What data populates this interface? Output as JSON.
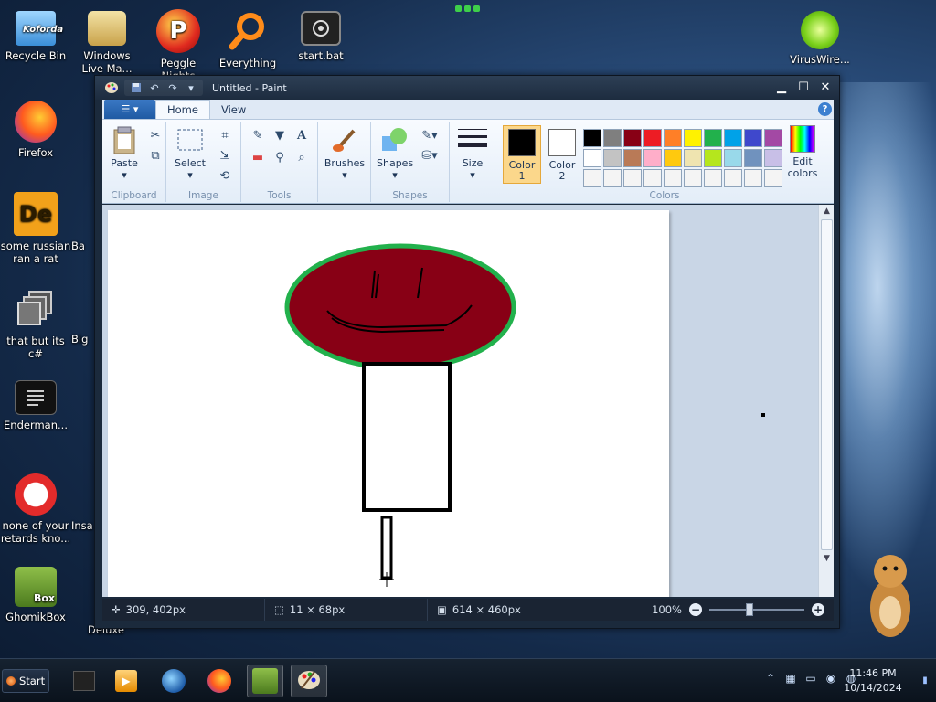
{
  "desktop": {
    "icons": [
      {
        "label": "Recycle Bin",
        "icon": "recycle-bin-icon"
      },
      {
        "label": "Windows Live Ma...",
        "icon": "windows-live-mail-icon"
      },
      {
        "label": "Peggle Nights",
        "icon": "peggle-icon"
      },
      {
        "label": "Everything",
        "icon": "search-magnifier-icon"
      },
      {
        "label": "start.bat",
        "icon": "batch-file-icon"
      },
      {
        "label": "VirusWire...",
        "icon": "lime-icon"
      },
      {
        "label": "Firefox",
        "icon": "firefox-icon"
      },
      {
        "label": "some russian ran a rat",
        "icon": "de-app-icon"
      },
      {
        "label": "that but its c#",
        "icon": "stacked-windows-icon"
      },
      {
        "label": "Enderman...",
        "icon": "console-icon"
      },
      {
        "label": "none of your retards kno...",
        "icon": "red-bird-icon"
      },
      {
        "label": "GhomikBox",
        "icon": "hamster-box-icon"
      },
      {
        "label": "Ba",
        "icon": "partial-icon"
      },
      {
        "label": "Big",
        "icon": "partial-icon"
      },
      {
        "label": "Insa",
        "icon": "partial-icon"
      },
      {
        "label": "Deluxe",
        "icon": "partial-icon"
      }
    ],
    "icon_text_badges": {
      "recycle": "Koforda",
      "de": "De",
      "ghomik": "Box"
    }
  },
  "paint": {
    "title": "Untitled - Paint",
    "tabs": [
      "Home",
      "View"
    ],
    "active_tab": "Home",
    "help": "?",
    "groups": {
      "clipboard": {
        "label": "Clipboard",
        "paste": "Paste"
      },
      "image": {
        "label": "Image",
        "select": "Select"
      },
      "tools": {
        "label": "Tools",
        "text_tool": "A"
      },
      "brushes": {
        "label": "Brushes"
      },
      "shapes": {
        "label": "Shapes",
        "shapes_btn": "Shapes"
      },
      "size": {
        "label": "Size"
      },
      "colors": {
        "label": "Colors",
        "color1": "Color 1",
        "color1_top": "Color",
        "color1_num": "1",
        "color2_top": "Color",
        "color2_num": "2",
        "edit_colors_top": "Edit",
        "edit_colors_bottom": "colors",
        "color1_value": "#000000",
        "color2_value": "#ffffff",
        "palette_row1": [
          "#000000",
          "#7f7f7f",
          "#880015",
          "#ed1c24",
          "#ff7f27",
          "#fff200",
          "#22b14c",
          "#00a2e8",
          "#3f48cc",
          "#a349a4"
        ],
        "palette_row2": [
          "#ffffff",
          "#c3c3c3",
          "#b97a57",
          "#ffaec9",
          "#ffc90e",
          "#efe4b0",
          "#b5e61d",
          "#99d9ea",
          "#7092be",
          "#c8bfe7"
        ],
        "palette_row3": [
          "#f4f4f4",
          "#f4f4f4",
          "#f4f4f4",
          "#f4f4f4",
          "#f4f4f4",
          "#f4f4f4",
          "#f4f4f4",
          "#f4f4f4",
          "#f4f4f4",
          "#f4f4f4"
        ]
      }
    },
    "drawing": {
      "face_fill": "#880015",
      "face_outline": "#22b14c"
    },
    "status": {
      "cursor_pos": "309, 402px",
      "selection_size": "11 × 68px",
      "canvas_size": "614 × 460px",
      "zoom": "100%"
    }
  },
  "taskbar": {
    "start_label": "Start",
    "pinned": [
      "terminal-icon",
      "media-player-icon",
      "ie-globe-icon",
      "firefox-icon",
      "hamster-box-icon",
      "paint-icon"
    ],
    "clock_time": "11:46 PM",
    "clock_date": "10/14/2024"
  }
}
